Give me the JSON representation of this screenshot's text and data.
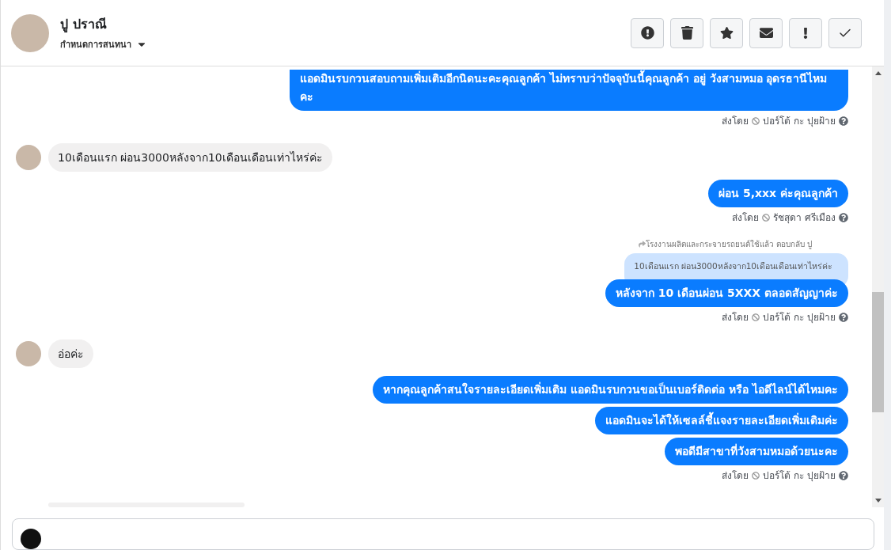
{
  "header": {
    "name": "ปู ปราณี",
    "action": "กำหนดการสนทนา"
  },
  "messages": [
    {
      "kind": "outgoing",
      "text": "แอดมินรบกวนสอบถามเพิ่มเติมอีกนิดนะคะคุณลูกค้า ไม่ทราบว่าปัจจุบันนี้คุณลูกค้า อยู่ วังสามหมอ อุดรธานีไหมคะ"
    },
    {
      "kind": "sent_by",
      "label": "ส่งโดย",
      "text": "ปอร์โต้ กะ ปุยฝ้าย"
    },
    {
      "kind": "incoming",
      "text": "10เดือนแรก  ผ่อน3000หลังจาก10เดือนเดือนเท่าไหร่ค่ะ"
    },
    {
      "kind": "outgoing",
      "text": "ผ่อน 5,xxx ค่ะคุณลูกค้า"
    },
    {
      "kind": "sent_by",
      "label": "ส่งโดย",
      "text": "รัชสุดา ศรีเมือง"
    },
    {
      "kind": "reply_note",
      "text": "โรงงานผลิตและกระจายรถยนต์ใช้แล้ว ตอบกลับ ปู"
    },
    {
      "kind": "quoted",
      "text": "10เดือนแรก ผ่อน3000หลังจาก10เดือนเดือนเท่าไหร่ค่ะ"
    },
    {
      "kind": "outgoing",
      "text": "หลังจาก 10 เดือนผ่อน 5XXX ตลอดสัญญาค่ะ"
    },
    {
      "kind": "sent_by",
      "label": "ส่งโดย",
      "text": "ปอร์โต้ กะ ปุยฝ้าย"
    },
    {
      "kind": "incoming",
      "text": "อ่อค่ะ"
    },
    {
      "kind": "outgoing",
      "text": "หากคุณลูกค้าสนใจรายละเอียดเพิ่มเติม แอดมินรบกวนขอเป็นเบอร์ติดต่อ หรือ ไอดีไลน์ได้ไหมคะ"
    },
    {
      "kind": "outgoing",
      "text": "แอดมินจะได้ให้เซลล์ชี้แจงรายละเอียดเพิ่มเติมค่ะ"
    },
    {
      "kind": "outgoing",
      "text": "พอดีมีสาขาที่วังสามหมอด้วยนะคะ"
    },
    {
      "kind": "sent_by",
      "label": "ส่งโดย",
      "text": "ปอร์โต้ กะ ปุยฝ้าย"
    },
    {
      "kind": "incoming_cut"
    }
  ]
}
